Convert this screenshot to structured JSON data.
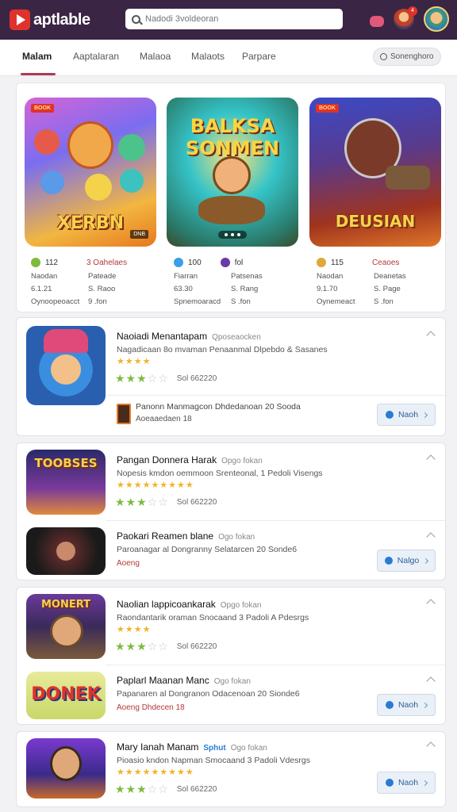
{
  "app": {
    "name": "aptlable"
  },
  "search": {
    "placeholder": "Nadodi 3voldeoran"
  },
  "header": {
    "notification_count": "4"
  },
  "tabs": [
    {
      "label": "Malam",
      "active": true
    },
    {
      "label": "Aaptalaran"
    },
    {
      "label": "Malaoa"
    },
    {
      "label": "Malaots"
    },
    {
      "label": "Parpare"
    }
  ],
  "tab_search_label": "Sonenghoro",
  "featured": [
    {
      "title": "XERBN",
      "tag": "BOOK",
      "badge": "DNB",
      "rating": "112",
      "rating_label": "3 Oahelaes",
      "col1": [
        "Naodan",
        "6.1.21",
        "Oynoopeoacct"
      ],
      "col2": [
        "Pateade",
        "S. Raoo",
        "9 .fon"
      ]
    },
    {
      "title": "BALKSA SONMEN",
      "rating": "100",
      "rating_label": "fol",
      "col1": [
        "Fiarran",
        "63.30",
        "Spnemoaracd"
      ],
      "col2": [
        "Patsenas",
        "S. Rang",
        "S .fon"
      ]
    },
    {
      "title": "DEUSIAN",
      "tag": "BOOK",
      "rating": "115",
      "rating_label": "Ceaoes",
      "col1": [
        "Naodan",
        "9.1.70",
        "Oynemeact"
      ],
      "col2": [
        "Deanetas",
        "S. Page",
        "S .fon"
      ]
    }
  ],
  "cards": [
    {
      "items": [
        {
          "title": "Naoiadi Menantapam",
          "subtitle": "Qposeaocken",
          "desc": "Nagadicaan 8o mvaman Penaanmal Dlpebdo & Sasanes",
          "gold_stars": "★★★★",
          "stars_filled": 3,
          "stars_empty": 2,
          "reviews": "Sol 662220"
        },
        {
          "title": "Panonn Manmagcon Dhdedanoan 20 Sooda",
          "meta": "Aoeaaedaen 18",
          "button": "Naoh"
        }
      ]
    },
    {
      "items": [
        {
          "title": "Pangan Donnera Harak",
          "subtitle": "Opgo fokan",
          "desc": "Nopesis kmdon oemmoon Srenteonal, 1 Pedoli Visengs",
          "gold_stars": "★★★★★★★★★",
          "stars_filled": 3,
          "stars_empty": 2,
          "reviews": "Sol 662220"
        },
        {
          "title": "Paokari Reamen blane",
          "subtitle": "Ogo fokan",
          "desc": "Paroanagar al Dongranny Selatarcen 20 Sonde6",
          "meta": "Aoeng",
          "button": "Nalgo"
        }
      ]
    },
    {
      "items": [
        {
          "title": "Naolian lappicoankarak",
          "subtitle": "Opgo fokan",
          "desc": "Raondantarik oraman Snocaand 3 Padoli A Pdesrgs",
          "gold_stars": "★★★★",
          "stars_filled": 3,
          "stars_empty": 2,
          "reviews": "Sol 662220"
        },
        {
          "title": "Paplarl Maanan Manc",
          "subtitle": "Ogo fokan",
          "desc": "Papanaren al Dongranon Odacenoan 20 Sionde6",
          "meta": "Aoeng Dhdecen 18",
          "button": "Naoh"
        }
      ]
    },
    {
      "items": [
        {
          "title": "Mary Ianah Manam",
          "subtitle": "Sphut",
          "subtitle2": "Ogo fokan",
          "desc": "Pioasio kndon Napman Smocaand 3 Padoli Vdesrgs",
          "gold_stars": "★★★★★★★★★",
          "stars_filled": 3,
          "stars_empty": 2,
          "reviews": "Sol 662220",
          "button": "Naoh"
        }
      ]
    }
  ],
  "thumb_labels": {
    "t2": "TOOBSES",
    "t4": "MONERT",
    "t5": "DONEK"
  }
}
